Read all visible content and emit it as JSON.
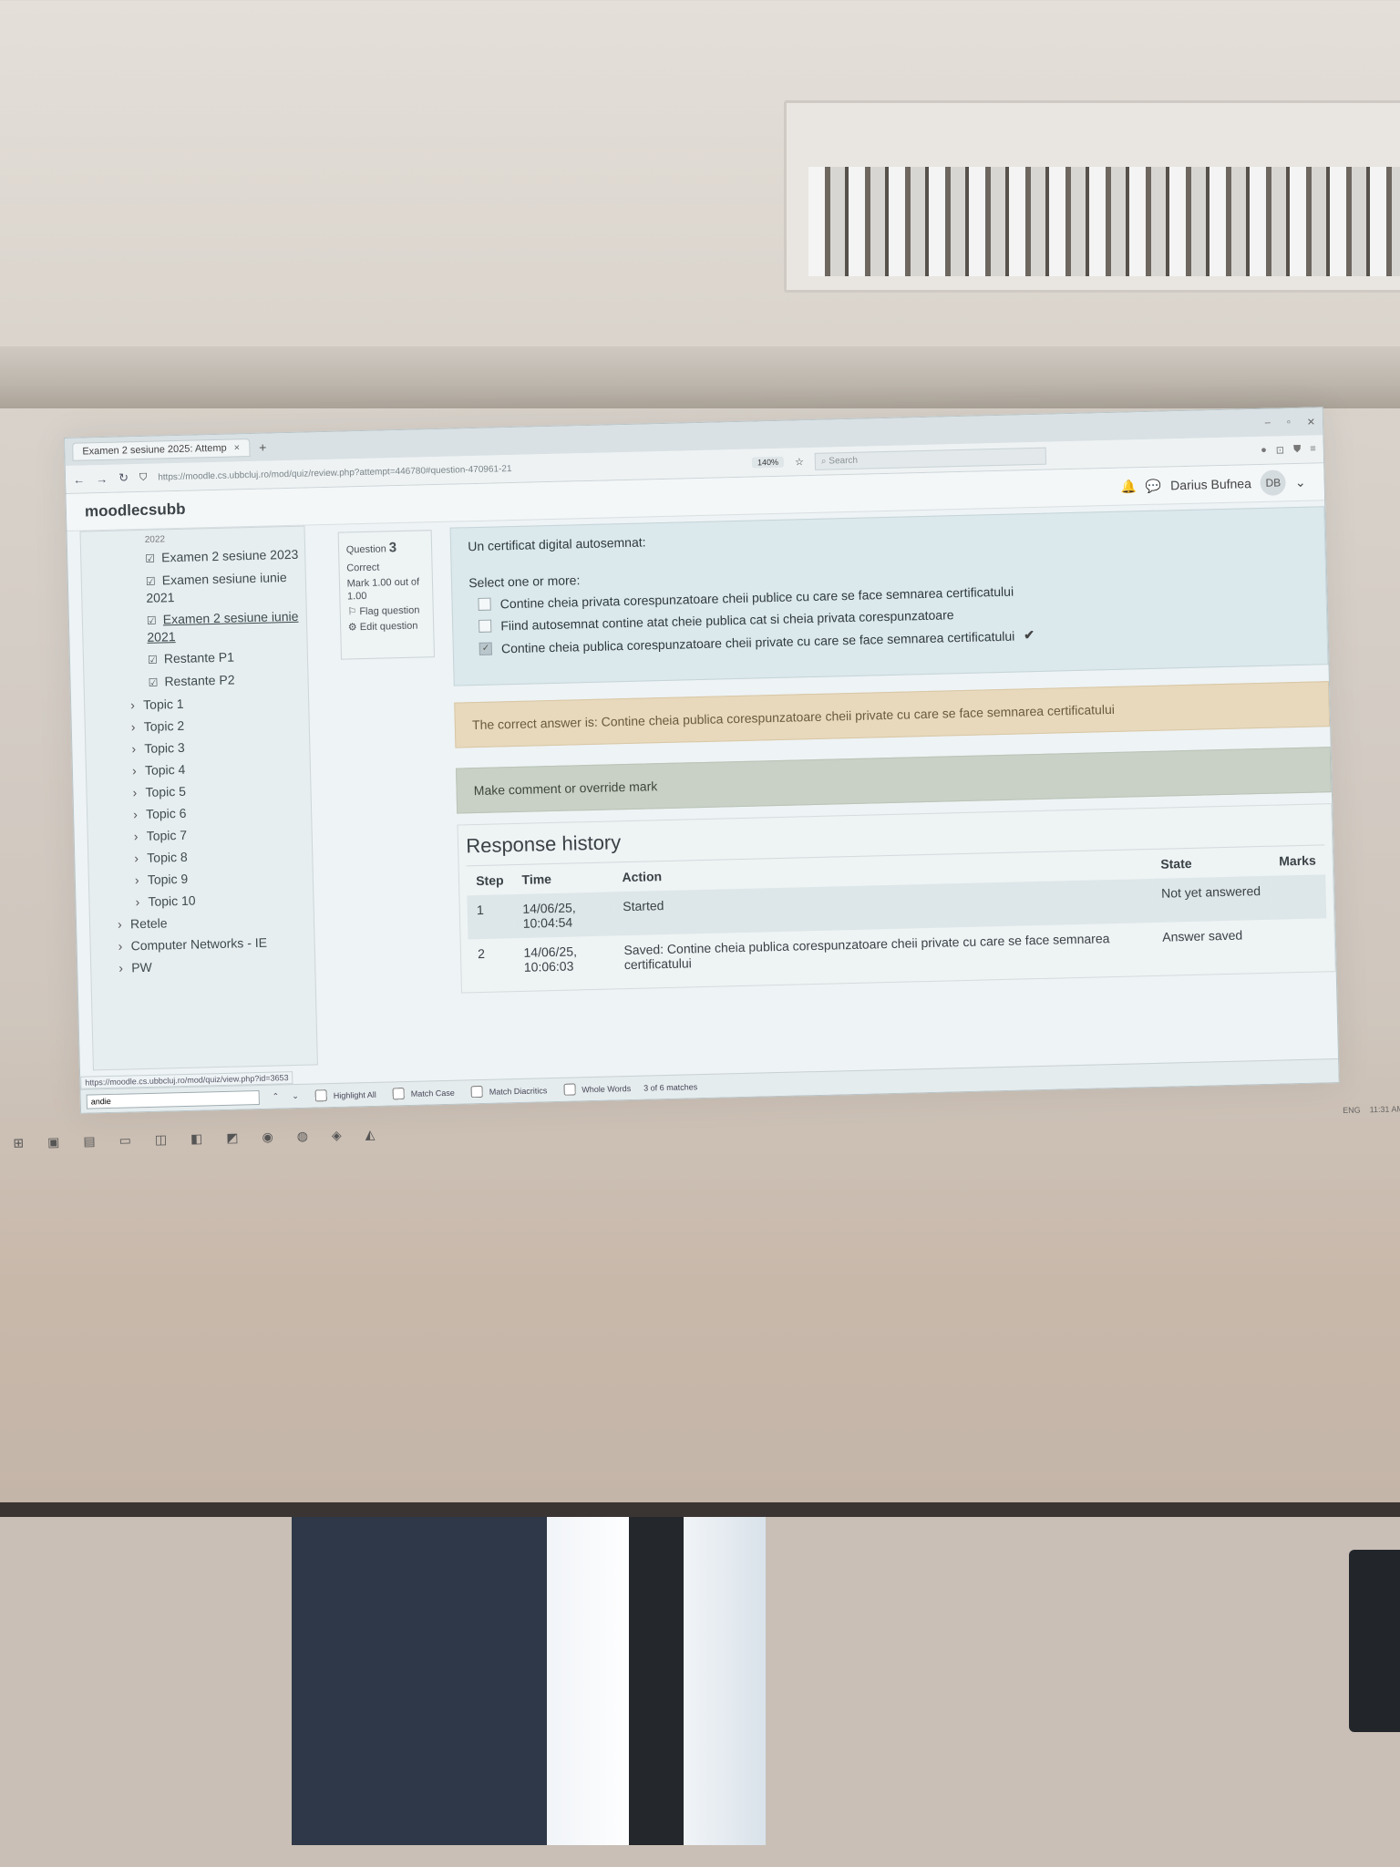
{
  "browser": {
    "tab_title": "Examen 2 sesiune 2025: Attemp",
    "tab_close": "×",
    "new_tab": "+",
    "url": "https://moodle.cs.ubbcluj.ro/mod/quiz/review.php?attempt=446780#question-470961-21",
    "zoom": "140%",
    "search_placeholder": "Search",
    "status_url": "https://moodle.cs.ubbcluj.ro/mod/quiz/view.php?id=3653"
  },
  "header": {
    "brand": "moodlecsubb",
    "user_name": "Darius Bufnea",
    "user_initials": "DB"
  },
  "sidebar": {
    "truncated_top": "2022",
    "exam_items": [
      {
        "label": "Examen 2 sesiune 2023"
      },
      {
        "label": "Examen sesiune iunie 2021"
      },
      {
        "label": "Examen 2 sesiune iunie 2021"
      },
      {
        "label": "Restante P1"
      },
      {
        "label": "Restante P2"
      }
    ],
    "topics": [
      "Topic 1",
      "Topic 2",
      "Topic 3",
      "Topic 4",
      "Topic 5",
      "Topic 6",
      "Topic 7",
      "Topic 8",
      "Topic 9",
      "Topic 10"
    ],
    "sections": [
      "Retele",
      "Computer Networks - IE",
      "PW"
    ]
  },
  "question_info": {
    "label": "Question",
    "number": "3",
    "state": "Correct",
    "mark": "Mark 1.00 out of 1.00",
    "flag": "Flag question",
    "edit": "Edit question"
  },
  "question": {
    "text": "Un certificat digital autosemnat:",
    "prompt": "Select one or more:",
    "options": [
      {
        "label": "Contine cheia privata corespunzatoare cheii publice cu care se face semnarea certificatului",
        "checked": false
      },
      {
        "label": "Fiind autosemnat contine atat cheie publica cat si cheia privata corespunzatoare",
        "checked": false
      },
      {
        "label": "Contine cheia publica corespunzatoare cheii private cu care se face semnarea certificatului",
        "checked": true
      }
    ]
  },
  "feedback": {
    "correct_answer": "The correct answer is: Contine cheia publica corespunzatoare cheii private cu care se face semnarea certificatului"
  },
  "comment_link": "Make comment or override mark",
  "history": {
    "title": "Response history",
    "columns": [
      "Step",
      "Time",
      "Action",
      "State",
      "Marks"
    ],
    "rows": [
      {
        "step": "1",
        "time": "14/06/25, 10:04:54",
        "action": "Started",
        "state": "Not yet answered",
        "marks": ""
      },
      {
        "step": "2",
        "time": "14/06/25, 10:06:03",
        "action": "Saved: Contine cheia publica corespunzatoare cheii private cu care se face semnarea certificatului",
        "state": "Answer saved",
        "marks": ""
      }
    ]
  },
  "findbar": {
    "query": "andie",
    "highlight_all": "Highlight All",
    "match_case": "Match Case",
    "match_diacritics": "Match Diacritics",
    "whole_words": "Whole Words",
    "matches": "3 of 6 matches"
  },
  "tray": {
    "lang": "ENG",
    "time": "11:31 AM"
  },
  "colors": {
    "correct_feedback_bg": "#e8d9bd",
    "question_bg": "#dbe8ec",
    "comment_bg": "#c9d1c6"
  }
}
